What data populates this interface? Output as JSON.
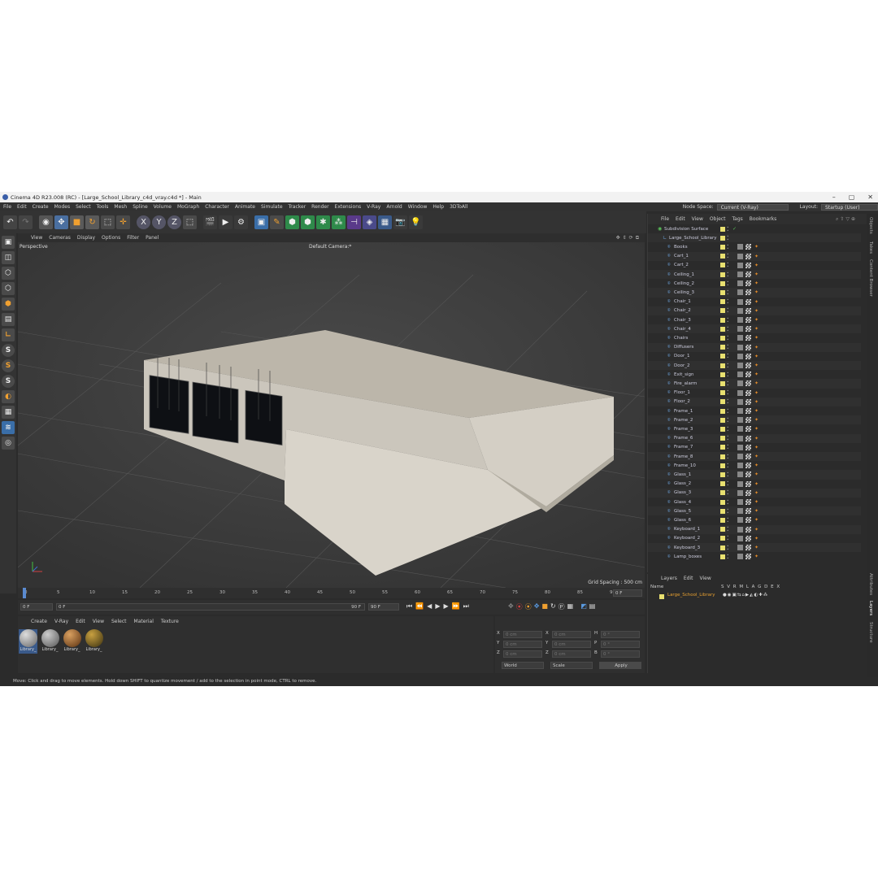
{
  "window": {
    "title": "Cinema 4D R23.008 (RC) - [Large_School_Library_c4d_vray.c4d *] - Main",
    "controls": [
      "–",
      "▢",
      "✕"
    ]
  },
  "menu": [
    "File",
    "Edit",
    "Create",
    "Modes",
    "Select",
    "Tools",
    "Mesh",
    "Spline",
    "Volume",
    "MoGraph",
    "Character",
    "Animate",
    "Simulate",
    "Tracker",
    "Render",
    "Extensions",
    "V-Ray",
    "Arnold",
    "Window",
    "Help",
    "3DToAll"
  ],
  "nodespace": {
    "label": "Node Space:",
    "value": "Current (V-Ray)",
    "layout_label": "Layout:",
    "layout_value": "Startup (User)"
  },
  "viewport": {
    "menu": [
      "View",
      "Cameras",
      "Display",
      "Options",
      "Filter",
      "Panel"
    ],
    "mode": "Perspective",
    "camera": "Default Camera:*",
    "grid_spacing": "Grid Spacing : 500 cm"
  },
  "timeline": {
    "ticks": [
      "0",
      "5",
      "10",
      "15",
      "20",
      "25",
      "30",
      "35",
      "40",
      "45",
      "50",
      "55",
      "60",
      "65",
      "70",
      "75",
      "80",
      "85",
      "90"
    ],
    "frame_right": "0 F",
    "start": "0 F",
    "current": "0 F",
    "end_a": "90 F",
    "end_b": "90 F"
  },
  "materials": {
    "menu": [
      "Create",
      "V-Ray",
      "Edit",
      "View",
      "Select",
      "Material",
      "Texture"
    ],
    "items": [
      "Library_",
      "Library_",
      "Library_",
      "Library_"
    ]
  },
  "coords": {
    "rows": [
      [
        "X",
        "0 cm",
        "X",
        "0 cm",
        "H",
        "0 °"
      ],
      [
        "Y",
        "0 cm",
        "Y",
        "0 cm",
        "P",
        "0 °"
      ],
      [
        "Z",
        "0 cm",
        "Z",
        "0 cm",
        "B",
        "0 °"
      ]
    ],
    "world": "World",
    "scale": "Scale",
    "apply": "Apply"
  },
  "status": "Move: Click and drag to move elements. Hold down SHIFT to quantize movement / add to the selection in point mode, CTRL to remove.",
  "objects": {
    "menu": [
      "File",
      "Edit",
      "View",
      "Object",
      "Tags",
      "Bookmarks"
    ],
    "root": "Subdivision Surface",
    "group": "Large_School_Library",
    "items": [
      "Books",
      "Cart_1",
      "Cart_2",
      "Ceiling_1",
      "Ceiling_2",
      "Ceiling_3",
      "Chair_1",
      "Chair_2",
      "Chair_3",
      "Chair_4",
      "Chairs",
      "Diffusers",
      "Door_1",
      "Door_2",
      "Exit_sign",
      "Fire_alarm",
      "Floor_1",
      "Floor_2",
      "Frame_1",
      "Frame_2",
      "Frame_3",
      "Frame_6",
      "Frame_7",
      "Frame_8",
      "Frame_10",
      "Glass_1",
      "Glass_2",
      "Glass_3",
      "Glass_4",
      "Glass_5",
      "Glass_6",
      "Keyboard_1",
      "Keyboard_2",
      "Keyboard_3",
      "Lamp_boxes"
    ]
  },
  "layers": {
    "menu": [
      "Layers",
      "Edit",
      "View"
    ],
    "header_name": "Name",
    "header_flags": "S V R M L A G D E X",
    "layer": "Large_School_Library"
  },
  "sidetabs": [
    "Objects",
    "Takes",
    "Content Browser",
    "Attributes",
    "Layers",
    "Structure"
  ],
  "colors": {
    "accent": "#e8e070",
    "layer": "#e8a030",
    "bg": "#2b2b2b"
  }
}
